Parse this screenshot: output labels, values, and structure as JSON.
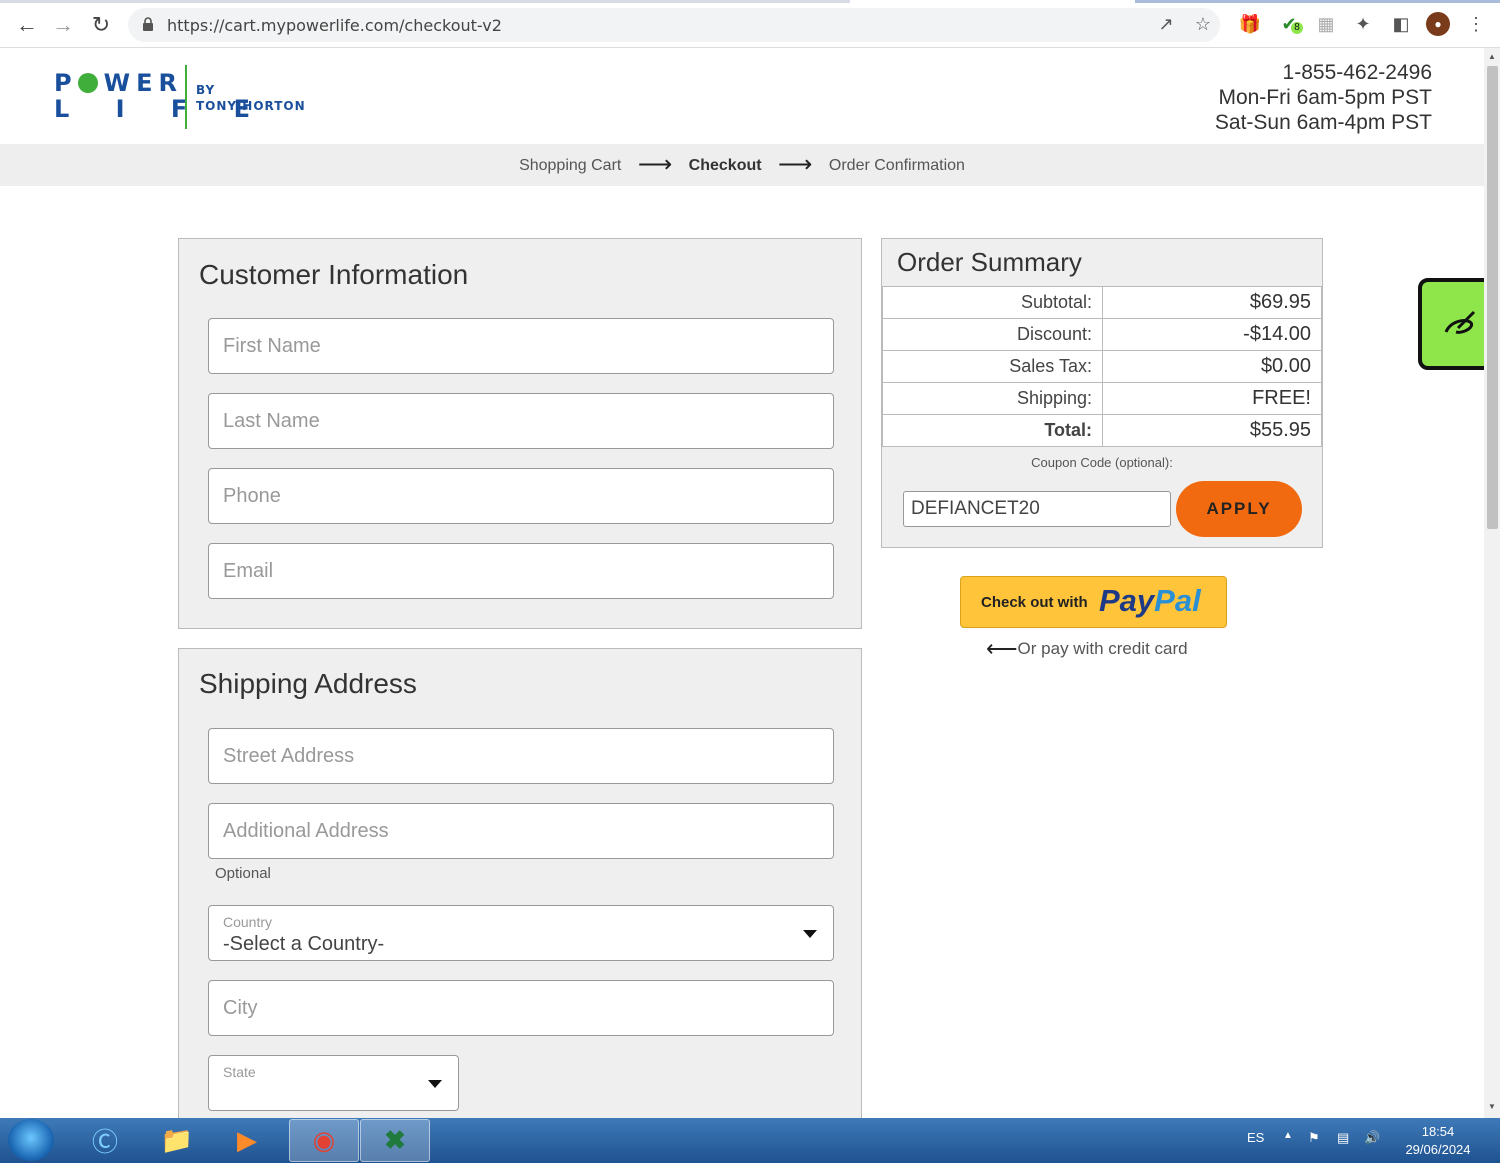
{
  "browser": {
    "url": "https://cart.mypowerlife.com/checkout-v2",
    "extension_badge": "8"
  },
  "header": {
    "logo_line1": "P WER",
    "logo_line2": "L I F E",
    "logo_by": "BY",
    "logo_brand": "TONY HORTON",
    "phone": "1-855-462-2496",
    "hours_weekday": "Mon-Fri 6am-5pm PST",
    "hours_weekend": "Sat-Sun 6am-4pm PST"
  },
  "steps": {
    "cart": "Shopping Cart",
    "checkout": "Checkout",
    "confirmation": "Order Confirmation"
  },
  "customer": {
    "title": "Customer Information",
    "first_name_ph": "First Name",
    "last_name_ph": "Last Name",
    "phone_ph": "Phone",
    "email_ph": "Email"
  },
  "shipping": {
    "title": "Shipping Address",
    "street_ph": "Street Address",
    "additional_ph": "Additional Address",
    "optional_note": "Optional",
    "country_label": "Country",
    "country_value": "-Select a Country-",
    "city_ph": "City",
    "state_label": "State"
  },
  "summary": {
    "title": "Order Summary",
    "rows": [
      {
        "label": "Subtotal:",
        "value": "$69.95"
      },
      {
        "label": "Discount:",
        "value": "-$14.00"
      },
      {
        "label": "Sales Tax:",
        "value": "$0.00"
      },
      {
        "label": "Shipping:",
        "value": "FREE!"
      },
      {
        "label": "Total:",
        "value": "$55.95"
      }
    ],
    "coupon_label": "Coupon Code (optional):",
    "coupon_value": "DEFIANCET20",
    "apply_label": "APPLY"
  },
  "paypal": {
    "checkout_text": "Check out with",
    "brand_pay": "Pay",
    "brand_pal": "Pal",
    "alt_text": "Or pay with credit card"
  },
  "taskbar": {
    "language": "ES",
    "time": "18:54",
    "date": "29/06/2024"
  }
}
